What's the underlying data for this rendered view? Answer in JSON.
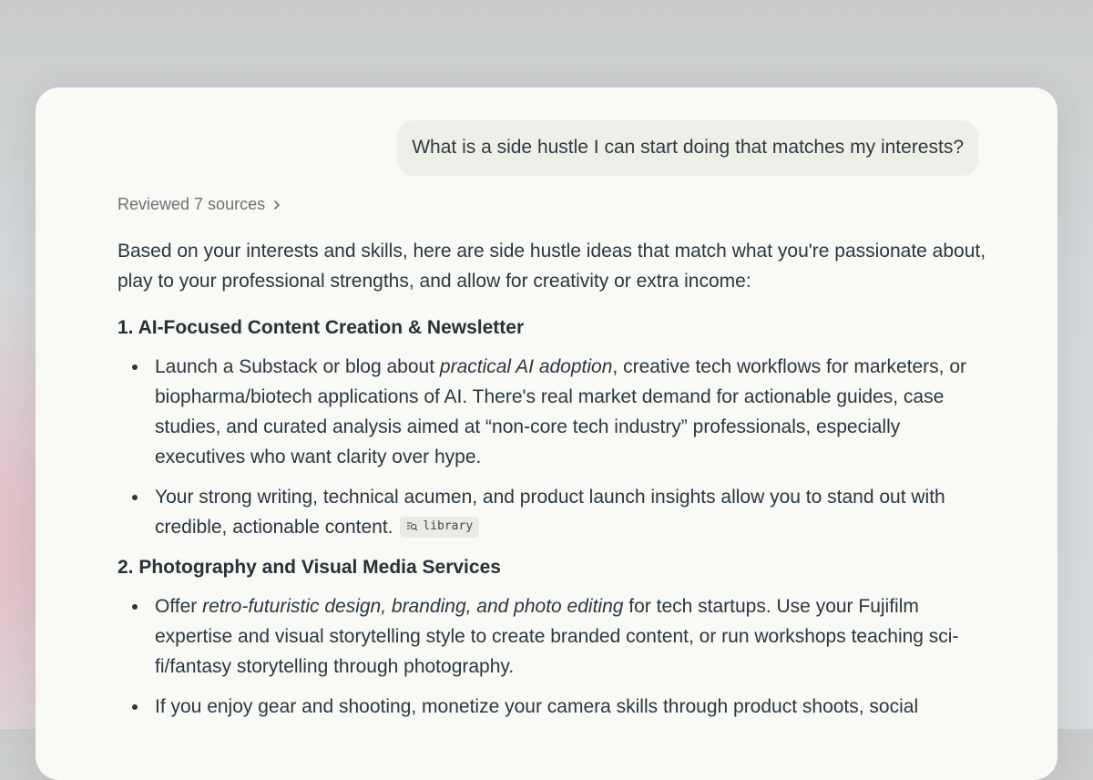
{
  "conversation": {
    "user_message": "What is a side hustle I can start doing that matches my interests?",
    "sources_label": "Reviewed 7 sources",
    "intro": "Based on your interests and skills, here are side hustle ideas that match what you're passionate about, play to your professional strengths, and allow for creativity or extra income:",
    "sections": [
      {
        "heading": "1. AI-Focused Content Creation & Newsletter",
        "b1_pre": "Launch a Substack or blog about ",
        "b1_em": "practical AI adoption",
        "b1_post": ", creative tech workflows for marketers, or biopharma/biotech applications of AI. There's real market demand for actionable guides, case studies, and curated analysis aimed at “non-core tech industry” professionals, especially executives who want clarity over hype.",
        "b2_text": "Your strong writing, technical acumen, and product launch insights allow you to stand out with credible, actionable content.",
        "b2_chip": "library"
      },
      {
        "heading": "2. Photography and Visual Media Services",
        "b1_pre": "Offer ",
        "b1_em": "retro-futuristic design, branding, and photo editing",
        "b1_post": " for tech startups. Use your Fujifilm expertise and visual storytelling style to create branded content, or run workshops teaching sci-fi/fantasy storytelling through photography.",
        "b2_text": "If you enjoy gear and shooting, monetize your camera skills through product shoots, social"
      }
    ]
  },
  "icons": {
    "sources_chevron": "chevron-right-icon",
    "chip_icon": "library-search-icon"
  }
}
